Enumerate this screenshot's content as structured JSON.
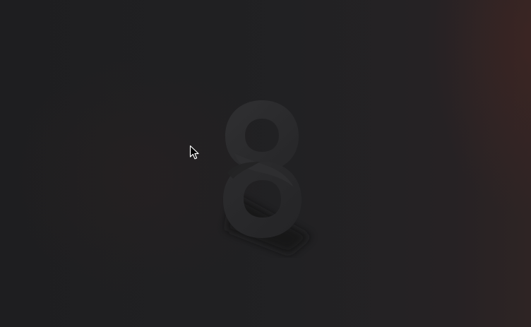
{
  "screen": {
    "colors": {
      "background": "#1f1f21",
      "glow": "#3a2624",
      "logo_face": "#2b2b2d",
      "logo_shadow": "#111113"
    }
  },
  "logo": {
    "icon": "figure-eight-logo-icon"
  },
  "cursor": {
    "icon": "mouse-pointer-icon"
  }
}
